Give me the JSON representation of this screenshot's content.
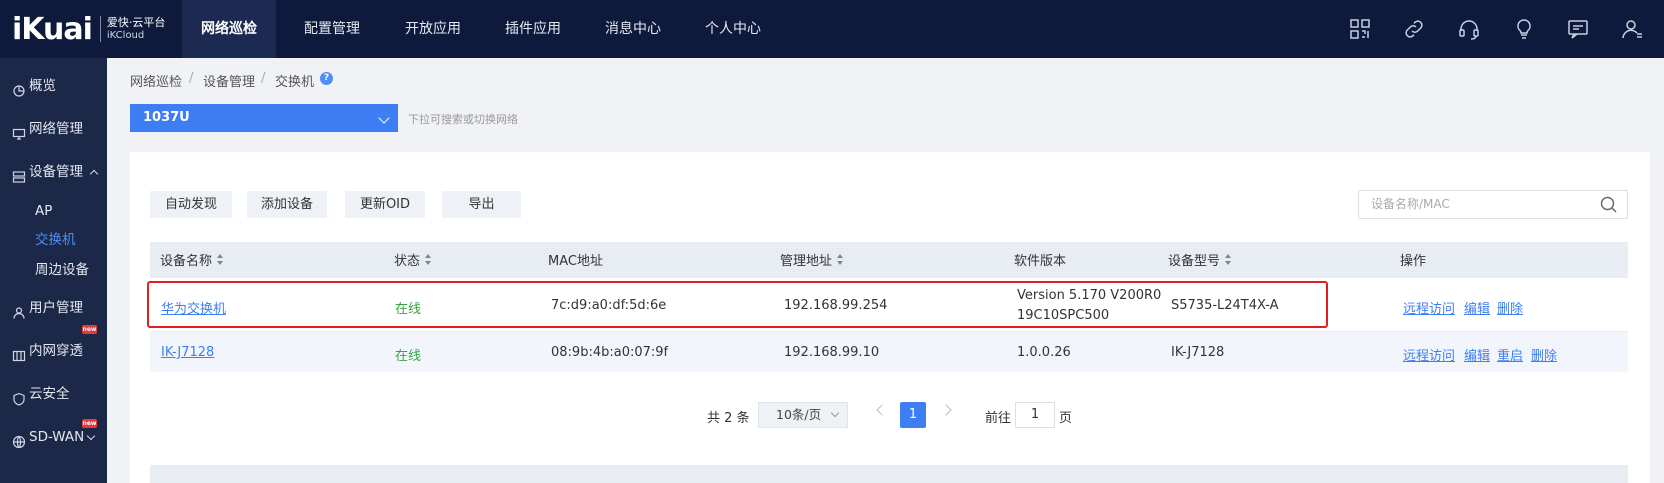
{
  "brand": {
    "mark": "iKuai",
    "line1": "爱快·云平台",
    "line2": "iKCloud"
  },
  "topnav": [
    {
      "label": "网络巡检",
      "active": true
    },
    {
      "label": "配置管理"
    },
    {
      "label": "开放应用"
    },
    {
      "label": "插件应用"
    },
    {
      "label": "消息中心"
    },
    {
      "label": "个人中心"
    }
  ],
  "sidebar": {
    "items": [
      {
        "label": "概览"
      },
      {
        "label": "网络管理"
      },
      {
        "label": "设备管理"
      },
      {
        "label": "用户管理"
      },
      {
        "label": "内网穿透",
        "badge": "new"
      },
      {
        "label": "云安全"
      },
      {
        "label": "SD-WAN",
        "badge": "new"
      }
    ],
    "subitems": [
      {
        "label": "AP"
      },
      {
        "label": "交换机",
        "active": true
      },
      {
        "label": "周边设备"
      }
    ]
  },
  "breadcrumb": [
    "网络巡检",
    "设备管理",
    "交换机"
  ],
  "crumb_sep": "/",
  "help_glyph": "?",
  "network_select": {
    "value": "1037U",
    "hint": "下拉可搜索或切换网络"
  },
  "toolbar": {
    "auto_discover": "自动发现",
    "add_device": "添加设备",
    "update_oid": "更新OID",
    "export": "导出"
  },
  "search": {
    "placeholder": "设备名称/MAC"
  },
  "table": {
    "columns": [
      "设备名称",
      "状态",
      "MAC地址",
      "管理地址",
      "软件版本",
      "设备型号",
      "操作"
    ],
    "rows": [
      {
        "name": "华为交换机",
        "status": "在线",
        "mac": "7c:d9:a0:df:5d:6e",
        "ip": "192.168.99.254",
        "version_l1": "Version 5.170 V200R0",
        "version_l2": "19C10SPC500",
        "model": "S5735-L24T4X-A",
        "ops": [
          "远程访问",
          "编辑",
          "删除"
        ]
      },
      {
        "name": "IK-J7128",
        "status": "在线",
        "mac": "08:9b:4b:a0:07:9f",
        "ip": "192.168.99.10",
        "version": "1.0.0.26",
        "model": "IK-J7128",
        "ops": [
          "远程访问",
          "编辑",
          "重启",
          "删除"
        ]
      }
    ]
  },
  "pagination": {
    "total": "共 2 条",
    "page_size": "10条/页",
    "current": "1",
    "goto_label": "前往",
    "goto_value": "1",
    "page_unit": "页"
  },
  "colors": {
    "accent": "#3d7ef5",
    "nav_bg": "#0d1a3c",
    "sidebar_bg": "#1b2847",
    "online": "#3aa245",
    "highlight": "#e0201e"
  }
}
